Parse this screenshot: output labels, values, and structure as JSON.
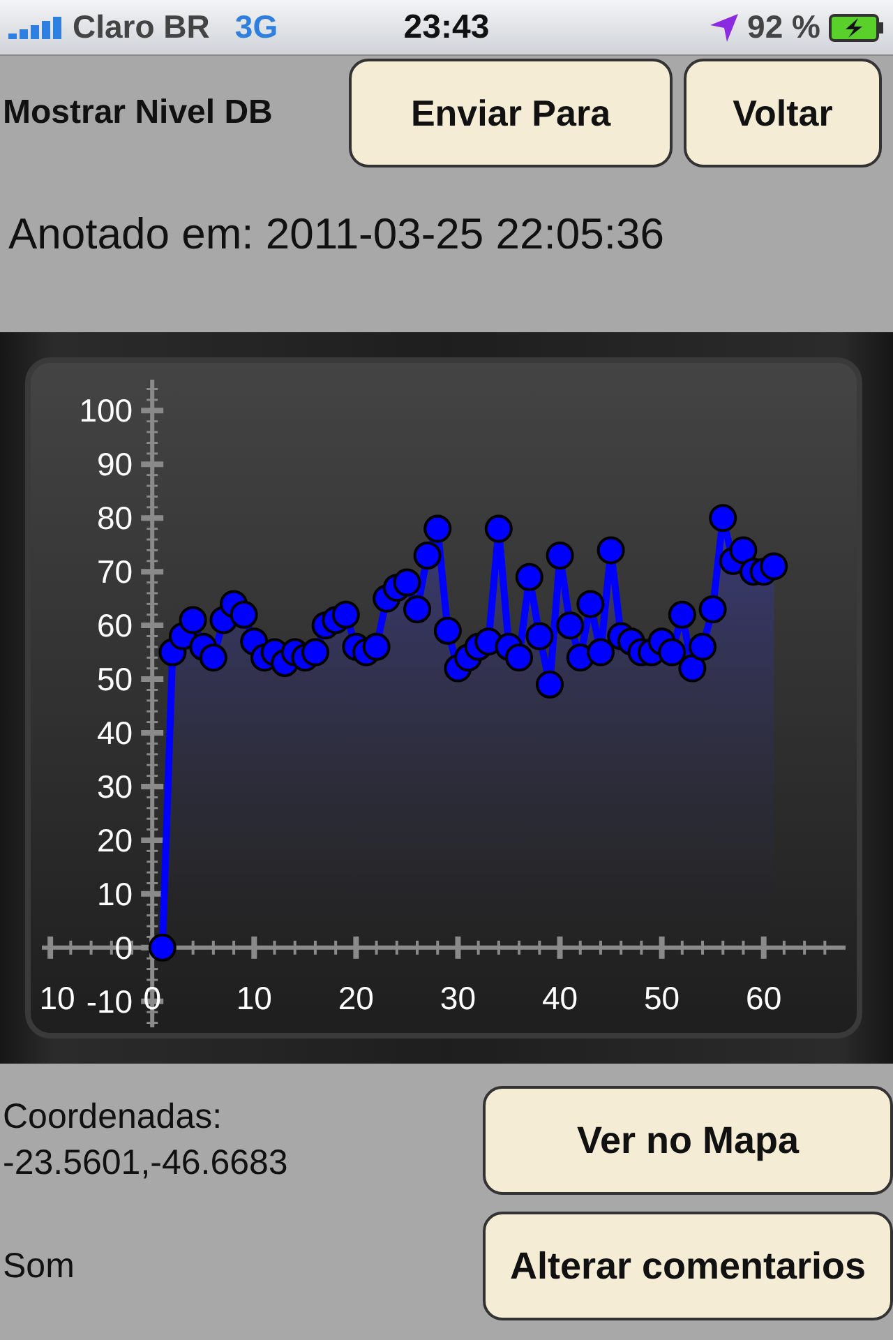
{
  "status_bar": {
    "carrier": "Claro BR",
    "network": "3G",
    "time": "23:43",
    "battery": "92 %"
  },
  "header": {
    "title": "Mostrar Nivel DB",
    "buttons": [
      "Enviar Para",
      "Voltar"
    ]
  },
  "annotated": "Anotado em: 2011-03-25 22:05:36",
  "chart_data": {
    "type": "area",
    "xlim": [
      -12.2,
      69.4
    ],
    "ylim": [
      -16.4,
      109.4
    ],
    "xticks": [
      {
        "value": -10,
        "label": "10"
      },
      0,
      10,
      20,
      30,
      40,
      50,
      60
    ],
    "yticks": [
      -10,
      0,
      10,
      20,
      30,
      40,
      50,
      60,
      70,
      80,
      90,
      100
    ],
    "x": [
      1,
      2,
      3,
      4,
      5,
      6,
      7,
      8,
      9,
      10,
      11,
      12,
      13,
      14,
      15,
      16,
      17,
      18,
      19,
      20,
      21,
      22,
      23,
      24,
      25,
      26,
      27,
      28,
      29,
      30,
      31,
      32,
      33,
      34,
      35,
      36,
      37,
      38,
      39,
      40,
      41,
      42,
      43,
      44,
      45,
      46,
      47,
      48,
      49,
      50,
      51,
      52,
      53,
      54,
      55,
      56,
      57,
      58,
      59,
      60,
      61
    ],
    "series": [
      {
        "color": "#0000ff",
        "values": [
          0,
          55,
          58,
          61,
          56,
          54,
          61,
          64,
          62,
          57,
          54,
          55,
          53,
          55,
          54,
          55,
          60,
          61,
          62,
          56,
          55,
          56,
          65,
          67,
          68,
          63,
          73,
          78,
          59,
          52,
          54,
          56,
          57,
          78,
          56,
          54,
          69,
          58,
          49,
          73,
          60,
          54,
          64,
          55,
          74,
          58,
          57,
          55,
          55,
          57,
          55,
          62,
          52,
          56,
          63,
          80,
          72,
          74,
          70,
          70,
          71
        ]
      }
    ]
  },
  "location": {
    "label": "Coordenadas:",
    "value": "-23.5601,-46.6683",
    "button": "Ver no Mapa"
  },
  "sound": {
    "label": "Som",
    "button": "Alterar comentarios"
  }
}
